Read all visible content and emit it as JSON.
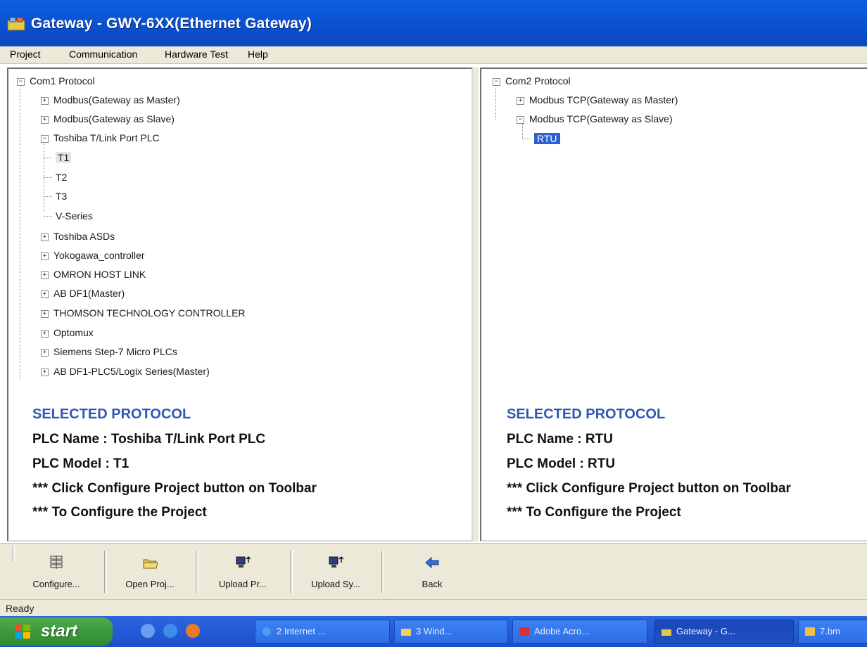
{
  "window": {
    "title": "Gateway - GWY-6XX(Ethernet Gateway)"
  },
  "menu": [
    "Project",
    "Communication",
    "Hardware Test",
    "Help"
  ],
  "left_pane": {
    "root": "Com1 Protocol",
    "items": [
      "Modbus(Gateway as Master)",
      "Modbus(Gateway as Slave)",
      "Toshiba T/Link Port PLC",
      "T1",
      "T2",
      "T3",
      "V-Series",
      "Toshiba ASDs",
      "Yokogawa_controller",
      "OMRON HOST LINK",
      "AB DF1(Master)",
      "THOMSON TECHNOLOGY CONTROLLER",
      "Optomux",
      "Siemens Step-7 Micro PLCs",
      "AB DF1-PLC5/Logix Series(Master)"
    ],
    "selected": {
      "heading": "SELECTED PROTOCOL",
      "plc_name": "PLC Name : Toshiba T/Link Port PLC",
      "plc_model": "PLC Model : T1",
      "hint1": "*** Click Configure Project button on Toolbar",
      "hint2": "*** To Configure the Project"
    }
  },
  "right_pane": {
    "root": "Com2 Protocol",
    "items": [
      "Modbus TCP(Gateway as Master)",
      "Modbus TCP(Gateway as Slave)",
      "RTU"
    ],
    "selected": {
      "heading": "SELECTED PROTOCOL",
      "plc_name": "PLC Name : RTU",
      "plc_model": "PLC Model : RTU",
      "hint1": "*** Click Configure Project button on Toolbar",
      "hint2": "*** To Configure the Project"
    }
  },
  "toolbar": {
    "configure": "Configure...",
    "open_project": "Open Proj...",
    "upload_project": "Upload Pr...",
    "upload_system": "Upload Sy...",
    "back": "Back"
  },
  "status": "Ready",
  "taskbar": {
    "start": "start",
    "tasks": [
      "2 Internet ...",
      "3 Wind...",
      "Adobe Acro...",
      "Gateway - G...",
      "7.bm"
    ]
  },
  "colors": {
    "title_bar": "#0a50cf",
    "selection": "#2b5fd2",
    "selected_heading": "#3157b4",
    "start_button": "#3c9a3c"
  }
}
